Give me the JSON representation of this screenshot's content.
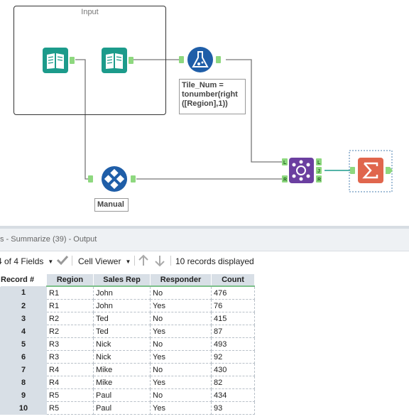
{
  "canvas": {
    "container_title": "Input",
    "annotations": {
      "formula_lines": [
        "Tile_Num =",
        "tonumber(right",
        "([Region],1))"
      ],
      "manual": "Manual"
    },
    "anchors": {
      "left": "L",
      "join": "J",
      "right": "R"
    },
    "colors": {
      "input": "#1c9b8b",
      "formula": "#1f5ea8",
      "tile": "#1f5ea8",
      "join": "#6b3fa0",
      "summarize": "#e0664d",
      "anchor": "#8ed87f"
    }
  },
  "results": {
    "title": "s - Summarize (39) - Output",
    "toolbar": {
      "fields": "4 of 4 Fields",
      "viewer": "Cell Viewer",
      "records": "10 records displayed"
    },
    "columns": [
      "Record #",
      "Region",
      "Sales Rep",
      "Responder",
      "Count"
    ],
    "rows": [
      [
        "1",
        "R1",
        "John",
        "No",
        "476"
      ],
      [
        "2",
        "R1",
        "John",
        "Yes",
        "76"
      ],
      [
        "3",
        "R2",
        "Ted",
        "No",
        "415"
      ],
      [
        "4",
        "R2",
        "Ted",
        "Yes",
        "87"
      ],
      [
        "5",
        "R3",
        "Nick",
        "No",
        "493"
      ],
      [
        "6",
        "R3",
        "Nick",
        "Yes",
        "92"
      ],
      [
        "7",
        "R4",
        "Mike",
        "No",
        "430"
      ],
      [
        "8",
        "R4",
        "Mike",
        "Yes",
        "82"
      ],
      [
        "9",
        "R5",
        "Paul",
        "No",
        "434"
      ],
      [
        "10",
        "R5",
        "Paul",
        "Yes",
        "93"
      ]
    ]
  }
}
